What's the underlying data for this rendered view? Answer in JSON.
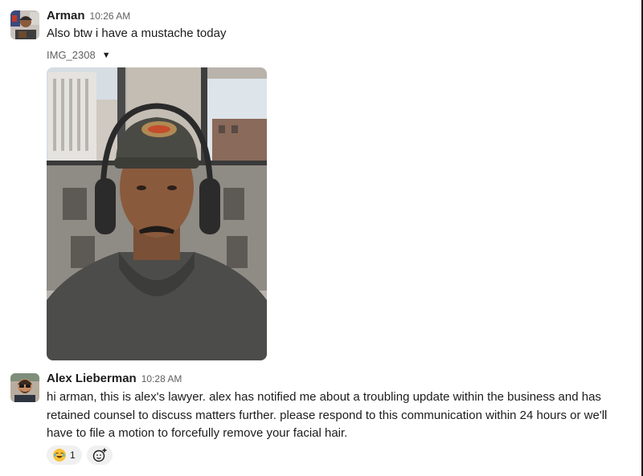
{
  "messages": [
    {
      "sender": "Arman",
      "time": "10:26 AM",
      "text": "Also btw i have a mustache today",
      "attachment": {
        "name": "IMG_2308",
        "toggle_icon": "caret-down-icon"
      }
    },
    {
      "sender": "Alex Lieberman",
      "time": "10:28 AM",
      "text": "hi arman, this is alex's lawyer. alex has notified me about a troubling update within the business and has retained counsel to discuss matters further. please respond to this communication within 24 hours or we'll have to file a motion to forcefully remove your facial hair.",
      "reactions": [
        {
          "emoji": "joy-emoji-icon",
          "count": "1"
        }
      ],
      "add_reaction_icon": "add-reaction-icon"
    }
  ],
  "colors": {
    "text": "#1d1c1d",
    "muted": "#616061",
    "pill": "#f0f0f0"
  }
}
